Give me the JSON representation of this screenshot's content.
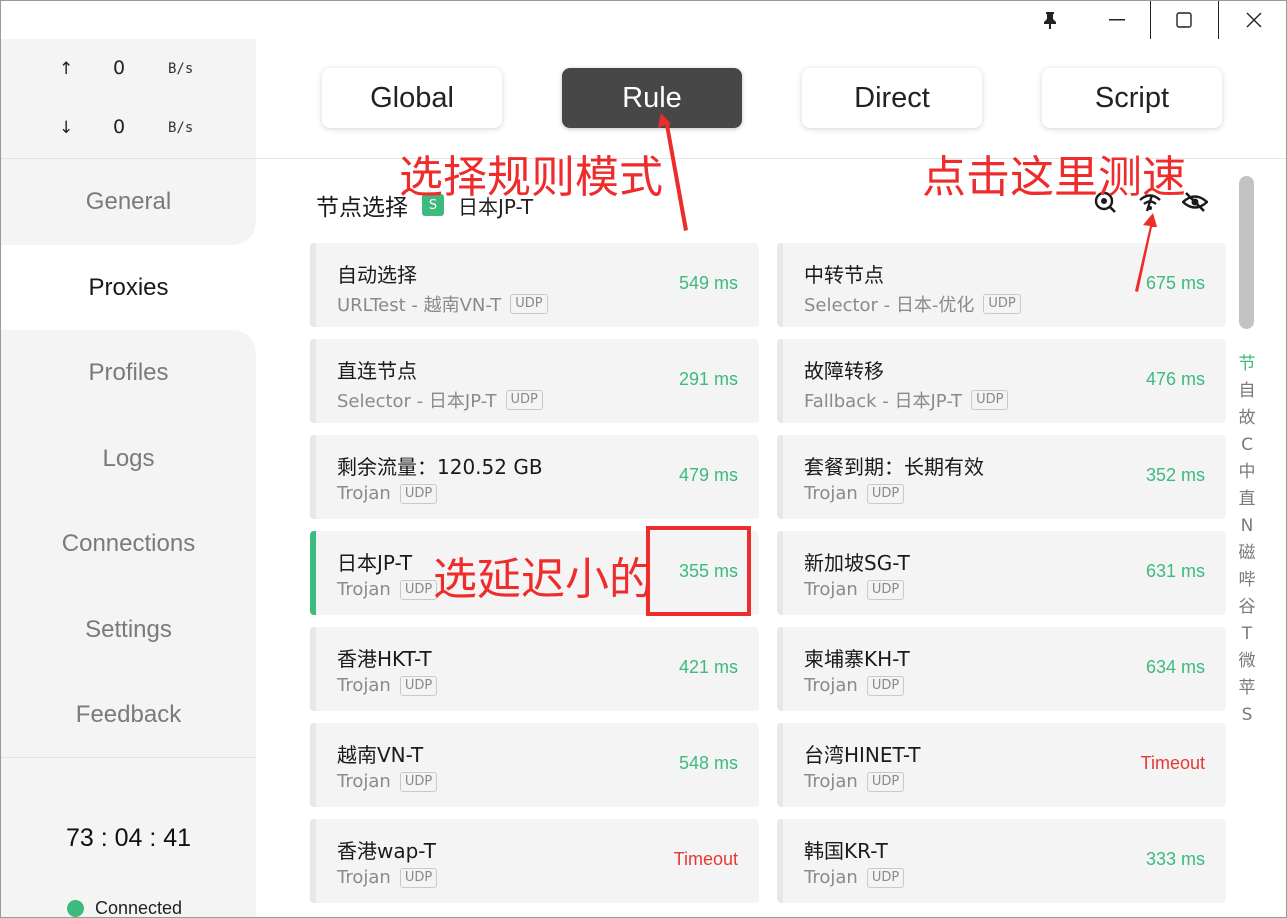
{
  "window": {
    "pin_icon": "pin-icon",
    "minimize_icon": "minimize-icon",
    "maximize_icon": "maximize-icon",
    "close_icon": "close-icon"
  },
  "traffic": {
    "upload_arrow": "↑",
    "upload_value": "0",
    "upload_unit": "B/s",
    "download_arrow": "↓",
    "download_value": "0",
    "download_unit": "B/s"
  },
  "nav": {
    "items": [
      {
        "label": "General"
      },
      {
        "label": "Proxies"
      },
      {
        "label": "Profiles"
      },
      {
        "label": "Logs"
      },
      {
        "label": "Connections"
      },
      {
        "label": "Settings"
      },
      {
        "label": "Feedback"
      }
    ],
    "active": "Proxies"
  },
  "status": {
    "timer": "73 : 04 : 41",
    "connection": "Connected",
    "connection_color": "#3dba7e"
  },
  "modes": {
    "items": [
      {
        "label": "Global"
      },
      {
        "label": "Rule"
      },
      {
        "label": "Direct"
      },
      {
        "label": "Script"
      }
    ],
    "active": "Rule"
  },
  "group": {
    "title": "节点选择",
    "badge": "S",
    "current": "日本JP-T",
    "icons": [
      "location-search-icon",
      "wifi-test-icon",
      "eye-off-icon"
    ]
  },
  "proxies": [
    {
      "name": "自动选择",
      "type": "URLTest - 越南VN-T",
      "udp": "UDP",
      "delay": "549 ms"
    },
    {
      "name": "中转节点",
      "type": "Selector - 日本-优化",
      "udp": "UDP",
      "delay": "675 ms"
    },
    {
      "name": "直连节点",
      "type": "Selector - 日本JP-T",
      "udp": "UDP",
      "delay": "291 ms"
    },
    {
      "name": "故障转移",
      "type": "Fallback - 日本JP-T",
      "udp": "UDP",
      "delay": "476 ms"
    },
    {
      "name": "剩余流量：120.52 GB",
      "type": "Trojan",
      "udp": "UDP",
      "delay": "479 ms"
    },
    {
      "name": "套餐到期：长期有效",
      "type": "Trojan",
      "udp": "UDP",
      "delay": "352 ms"
    },
    {
      "name": "日本JP-T",
      "type": "Trojan",
      "udp": "UDP",
      "delay": "355 ms",
      "selected": true
    },
    {
      "name": "新加坡SG-T",
      "type": "Trojan",
      "udp": "UDP",
      "delay": "631 ms"
    },
    {
      "name": "香港HKT-T",
      "type": "Trojan",
      "udp": "UDP",
      "delay": "421 ms"
    },
    {
      "name": "柬埔寨KH-T",
      "type": "Trojan",
      "udp": "UDP",
      "delay": "634 ms"
    },
    {
      "name": "越南VN-T",
      "type": "Trojan",
      "udp": "UDP",
      "delay": "548 ms"
    },
    {
      "name": "台湾HINET-T",
      "type": "Trojan",
      "udp": "UDP",
      "delay": "Timeout",
      "timeout": true
    },
    {
      "name": "香港wap-T",
      "type": "Trojan",
      "udp": "UDP",
      "delay": "Timeout",
      "timeout": true
    },
    {
      "name": "韩国KR-T",
      "type": "Trojan",
      "udp": "UDP",
      "delay": "333 ms"
    }
  ],
  "group_index": [
    "节",
    "自",
    "故",
    "C",
    "中",
    "直",
    "N",
    "磁",
    "哔",
    "谷",
    "T",
    "微",
    "苹",
    "S"
  ],
  "annotations": {
    "select_rule": "选择规则模式",
    "click_test": "点击这里测速",
    "pick_low": "选延迟小的",
    "color": "#ee2c2c"
  },
  "colors": {
    "accent": "#3dba7e",
    "timeout": "#e53935",
    "active_mode": "#474747"
  }
}
